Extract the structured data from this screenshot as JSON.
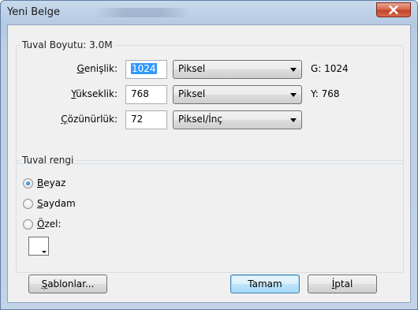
{
  "window": {
    "title": "Yeni Belge",
    "close_label": "✕"
  },
  "canvas_size": {
    "legend": "Tuval Boyutu: 3.0M",
    "width": {
      "label_mnemonic": "G",
      "label_rest": "enişlik:",
      "value": "1024",
      "unit": "Piksel",
      "info": "G: 1024"
    },
    "height": {
      "label_mnemonic": "Y",
      "label_rest": "ükseklik:",
      "value": "768",
      "unit": "Piksel",
      "info": "Y: 768"
    },
    "resolution": {
      "label_mnemonic": "Ç",
      "label_rest": "özünürlük:",
      "value": "72",
      "unit": "Piksel/İnç"
    }
  },
  "canvas_color": {
    "legend": "Tuval rengi",
    "options": [
      {
        "mnemonic": "B",
        "rest": "eyaz",
        "checked": true
      },
      {
        "mnemonic": "S",
        "rest": "aydam",
        "checked": false
      },
      {
        "mnemonic": "Ö",
        "rest": "zel:",
        "checked": false
      }
    ],
    "custom_color": "#ffffff"
  },
  "buttons": {
    "templates_mnemonic": "Ş",
    "templates_rest": "ablonlar...",
    "ok": "Tamam",
    "cancel_mnemonic": "İ",
    "cancel_rest": "ptal"
  }
}
